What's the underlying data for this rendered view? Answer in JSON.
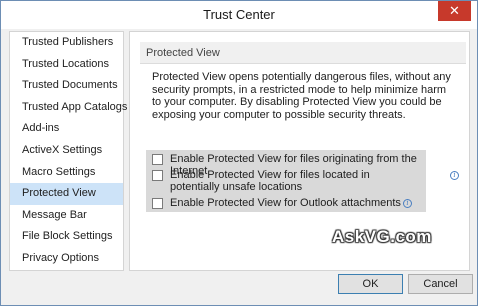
{
  "window": {
    "title": "Trust Center",
    "close_label": "✕"
  },
  "sidebar": {
    "items": [
      {
        "label": "Trusted Publishers"
      },
      {
        "label": "Trusted Locations"
      },
      {
        "label": "Trusted Documents"
      },
      {
        "label": "Trusted App Catalogs"
      },
      {
        "label": "Add-ins"
      },
      {
        "label": "ActiveX Settings"
      },
      {
        "label": "Macro Settings"
      },
      {
        "label": "Protected View",
        "selected": true
      },
      {
        "label": "Message Bar"
      },
      {
        "label": "File Block Settings"
      },
      {
        "label": "Privacy Options"
      }
    ]
  },
  "main": {
    "section_title": "Protected View",
    "description": "Protected View opens potentially dangerous files, without any security prompts, in a restricted mode to help minimize harm to your computer. By disabling Protected View you could be exposing your computer to possible security threats.",
    "options": [
      {
        "label": "Enable Protected View for files originating from the Internet",
        "checked": false
      },
      {
        "label": "Enable Protected View for files located in potentially unsafe locations",
        "checked": false
      },
      {
        "label": "Enable Protected View for Outlook attachments",
        "checked": false
      }
    ]
  },
  "watermark": "AskVG.com",
  "footer": {
    "ok_label": "OK",
    "cancel_label": "Cancel"
  },
  "colors": {
    "selection": "#cde3f8",
    "close_button": "#c7392b",
    "info_icon": "#4a7fc1"
  }
}
